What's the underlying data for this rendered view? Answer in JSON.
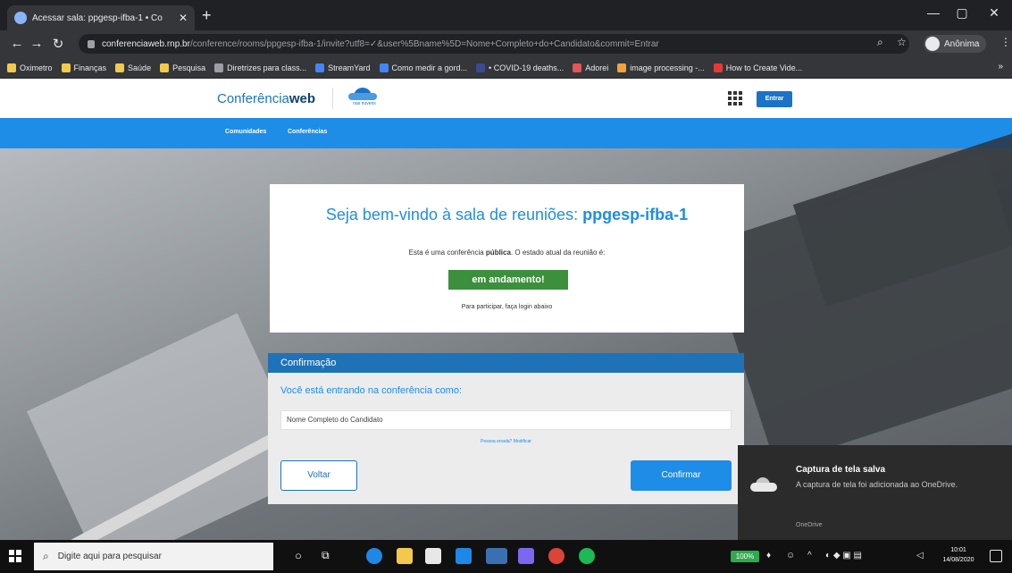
{
  "browser": {
    "tab_title": "Acessar sala: ppgesp-ifba-1 • Co",
    "tab_close": "✕",
    "new_tab": "+",
    "url_host": "conferenciaweb.rnp.br",
    "url_path": "/conference/rooms/ppgesp-ifba-1/invite?utf8=✓&user%5Bname%5D=Nome+Completo+do+Candidato&commit=Entrar",
    "profile_label": "Anônima",
    "bookmarks": [
      {
        "label": "Oximetro",
        "color": "#f2c94c"
      },
      {
        "label": "Finanças",
        "color": "#f2c94c"
      },
      {
        "label": "Saúde",
        "color": "#f2c94c"
      },
      {
        "label": "Pesquisa",
        "color": "#f2c94c"
      },
      {
        "label": "Diretrizes para class...",
        "color": "#9aa0a6"
      },
      {
        "label": "StreamYard",
        "color": "#4285f4"
      },
      {
        "label": "Como medir a gord...",
        "color": "#4285f4"
      },
      {
        "label": "• COVID-19 deaths...",
        "color": "#3c4a8f"
      },
      {
        "label": "Adorei",
        "color": "#e15759"
      },
      {
        "label": "image processing -...",
        "color": "#f2a43c"
      },
      {
        "label": "How to Create Vide...",
        "color": "#e53935"
      }
    ],
    "bookmarks_more": "»"
  },
  "site": {
    "logo_prefix": "Conferência",
    "logo_bold": "web",
    "cloud_text": "nas nuvens",
    "entrar_button": "Entrar",
    "nav": [
      "Comunidades",
      "Conferências"
    ]
  },
  "welcome": {
    "title_prefix": "Seja bem-vindo à sala de reuniões: ",
    "room_name": "ppgesp-ifba-1",
    "line_prefix": "Esta é uma conferência ",
    "line_bold": "pública",
    "line_suffix": ". O estado atual da reunião é:",
    "status": "em andamento!",
    "login_hint": "Para participar, faça login abaixo"
  },
  "confirm": {
    "header": "Confirmação",
    "label": "Você está entrando na conferência como:",
    "name_value": "Nome Completo do Candidato",
    "wrong_link": "Pessoa errada? Modificar",
    "back_button": "Voltar",
    "confirm_button": "Confirmar"
  },
  "toast": {
    "title": "Captura de tela salva",
    "message": "A captura de tela foi adicionada ao OneDrive.",
    "source": "OneDrive"
  },
  "taskbar": {
    "search_placeholder": "Digite aqui para pesquisar",
    "battery": "100%",
    "time": "10:01",
    "date": "14/08/2020"
  }
}
